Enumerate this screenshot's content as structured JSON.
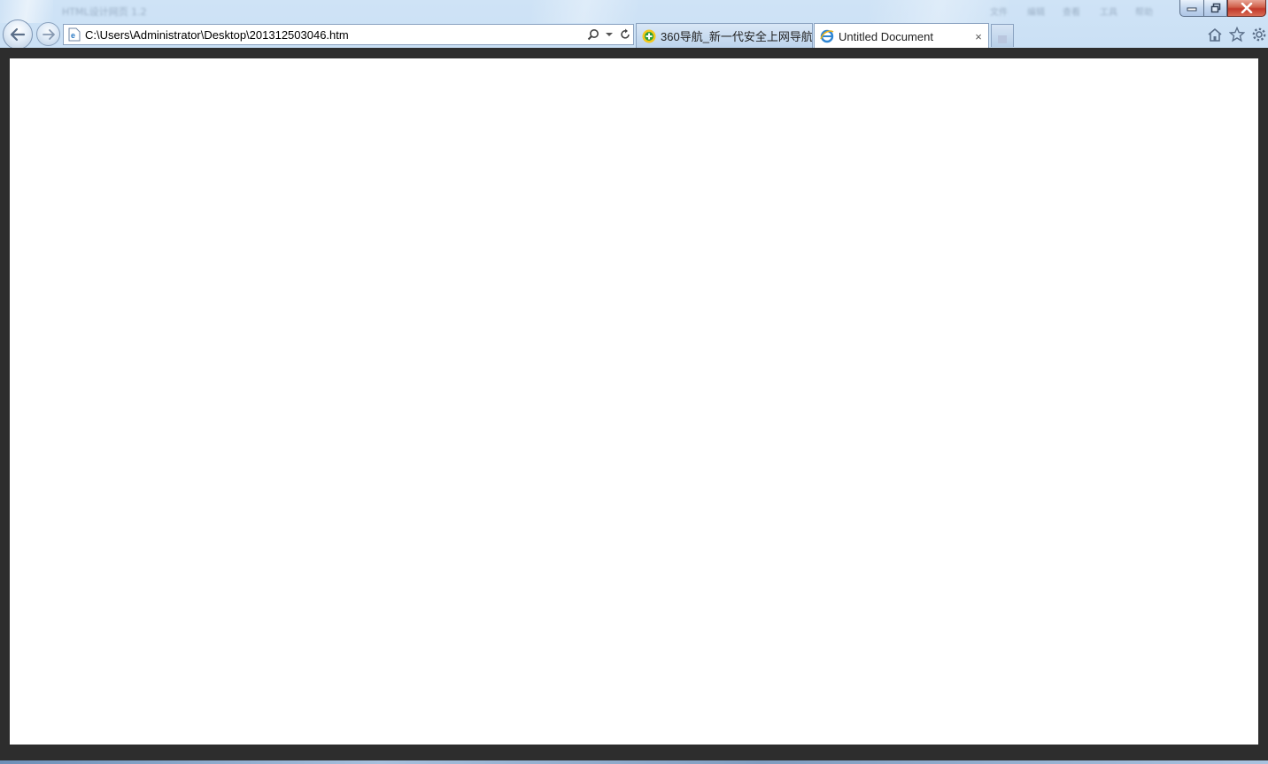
{
  "window": {
    "title_blurred": "HTML设计网页 1.2",
    "menu_blurred": [
      "文件",
      "编辑",
      "查看",
      "工具",
      "帮助"
    ]
  },
  "navigation": {
    "address": "C:\\Users\\Administrator\\Desktop\\201312503046.htm",
    "back_icon": "back-arrow-icon",
    "forward_icon": "forward-arrow-icon"
  },
  "tabs": [
    {
      "label": "360导航_新一代安全上网导航",
      "icon": "360-icon",
      "active": false
    },
    {
      "label": "Untitled Document",
      "icon": "ie-page-icon",
      "active": true,
      "close": "×"
    }
  ],
  "toolbar": {
    "icons": [
      "home-icon",
      "favorites-star-icon",
      "gear-icon"
    ]
  },
  "colors": {
    "chrome": "#b9d5f0",
    "frame": "#2d2d2d",
    "content": "#ffffff",
    "close_button": "#c2392a"
  }
}
